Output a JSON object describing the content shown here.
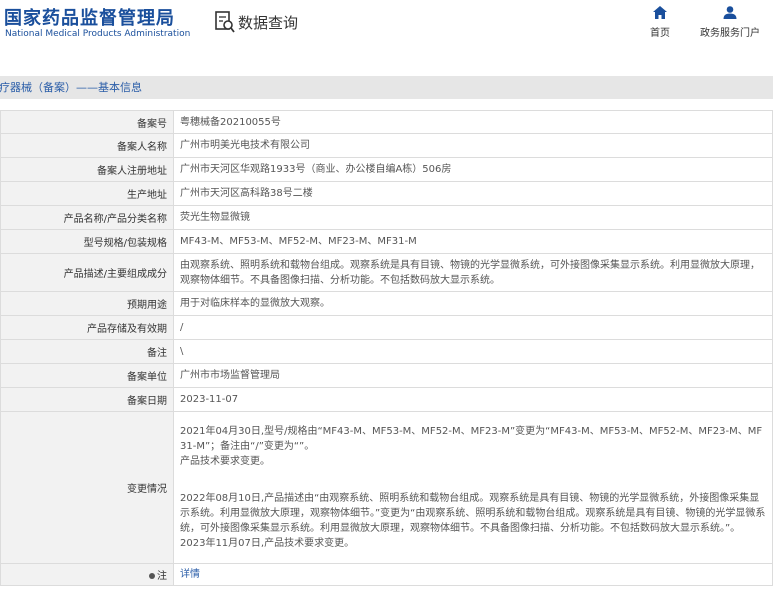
{
  "header": {
    "logo_cn": "国家药品监督管理局",
    "logo_en": "National Medical Products Administration",
    "query_label": "数据查询",
    "nav": [
      {
        "label": "首页",
        "icon": "home-icon"
      },
      {
        "label": "政务服务门户",
        "icon": "user-icon"
      }
    ],
    "accent_color": "#1a4f9c"
  },
  "section_title": "医疗器械（备案）——基本信息",
  "fields": [
    {
      "label": "备案号",
      "value": "粤穗械备20210055号"
    },
    {
      "label": "备案人名称",
      "value": "广州市明美光电技术有限公司"
    },
    {
      "label": "备案人注册地址",
      "value": "广州市天河区华观路1933号（商业、办公楼自编A栋）506房"
    },
    {
      "label": "生产地址",
      "value": "广州市天河区高科路38号二楼"
    },
    {
      "label": "产品名称/产品分类名称",
      "value": "荧光生物显微镜"
    },
    {
      "label": "型号规格/包装规格",
      "value": "MF43-M、MF53-M、MF52-M、MF23-M、MF31-M"
    },
    {
      "label": "产品描述/主要组成成分",
      "value": "由观察系统、照明系统和载物台组成。观察系统是具有目镜、物镜的光学显微系统，可外接图像采集显示系统。利用显微放大原理，观察物体细节。不具备图像扫描、分析功能。不包括数码放大显示系统。"
    },
    {
      "label": "预期用途",
      "value": "用于对临床样本的显微放大观察。"
    },
    {
      "label": "产品存储及有效期",
      "value": "/"
    },
    {
      "label": "备注",
      "value": "\\"
    },
    {
      "label": "备案单位",
      "value": "广州市市场监督管理局"
    },
    {
      "label": "备案日期",
      "value": "2023-11-07"
    }
  ],
  "change": {
    "label": "变更情况",
    "lines": [
      "2021年04月30日,型号/规格由“MF43-M、MF53-M、MF52-M、MF23-M”变更为“MF43-M、MF53-M、MF52-M、MF23-M、MF31-M”；备注由“/”变更为“”。",
      "产品技术要求变更。",
      "2022年08月10日,产品描述由“由观察系统、照明系统和载物台组成。观察系统是具有目镜、物镜的光学显微系统，外接图像采集显示系统。利用显微放大原理，观察物体细节。”变更为“由观察系统、照明系统和载物台组成。观察系统是具有目镜、物镜的光学显微系统，可外接图像采集显示系统。利用显微放大原理，观察物体细节。不具备图像扫描、分析功能。不包括数码放大显示系统。”。",
      "2023年11月07日,产品技术要求变更。"
    ]
  },
  "note": {
    "label": "注",
    "link": "详情"
  }
}
